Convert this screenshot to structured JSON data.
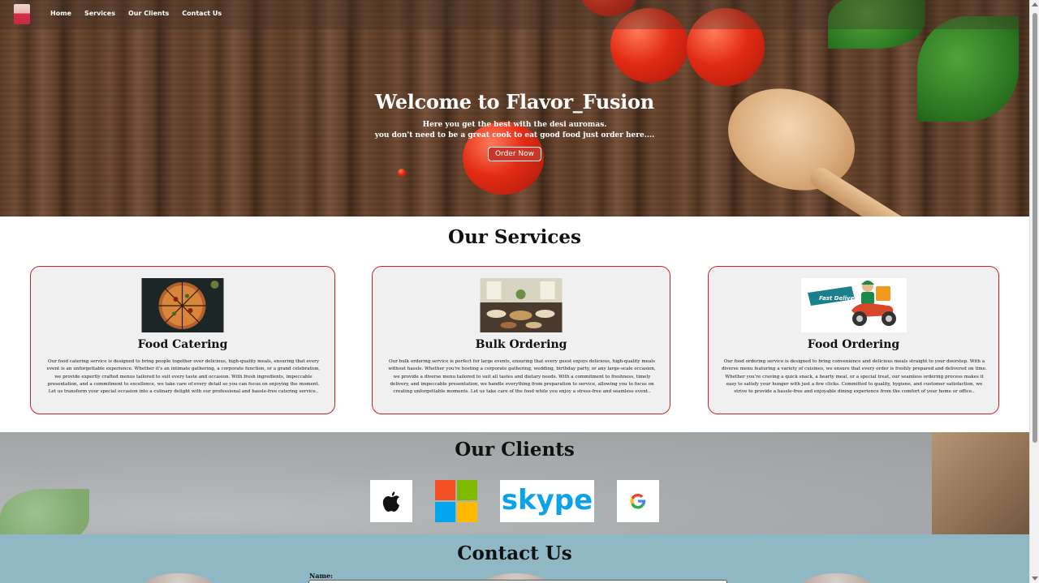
{
  "nav": {
    "links": [
      "Home",
      "Services",
      "Our Clients",
      "Contact Us"
    ]
  },
  "hero": {
    "title": "Welcome to Flavor_Fusion",
    "line1": "Here you get the best with the desi auromas.",
    "line2": "you don't need to be a great cook to eat good food just order here....",
    "button": "Order Now"
  },
  "services": {
    "title": "Our Services",
    "cards": [
      {
        "title": "Food Catering",
        "text": "Our food catering service is designed to bring people together over delicious, high-quality meals, ensuring that every event is an unforgettable experience. Whether it's an intimate gathering, a corporate function, or a grand celebration, we provide expertly crafted menus tailored to suit every taste and occasion. With fresh ingredients, impeccable presentation, and a commitment to excellence, we take care of every detail so you can focus on enjoying the moment. Let us transform your special occasion into a culinary delight with our professional and hassle-free catering service.."
      },
      {
        "title": "Bulk Ordering",
        "text": "Our bulk ordering service is perfect for large events, ensuring that every guest enjoys delicious, high-quality meals without hassle. Whether you're hosting a corporate gathering, wedding, birthday party, or any large-scale occasion, we provide a diverse menu tailored to suit all tastes and dietary needs. With a commitment to freshness, timely delivery, and impeccable presentation, we handle everything from preparation to service, allowing you to focus on creating unforgettable moments. Let us take care of the food while you enjoy a stress-free and seamless event.."
      },
      {
        "title": "Food Ordering",
        "text": "Our food ordering service is designed to bring convenience and delicious meals straight to your doorstep. With a diverse menu featuring a variety of cuisines, we ensure that every order is freshly prepared and delivered on time. Whether you're craving a quick snack, a hearty meal, or a special treat, our seamless ordering process makes it easy to satisfy your hunger with just a few clicks. Committed to quality, hygiene, and customer satisfaction, we strive to provide a hassle-free and enjoyable dining experience from the comfort of your home or office.."
      }
    ],
    "delivery_badge": "Fast Delivery"
  },
  "clients": {
    "title": "Our Clients",
    "logos": [
      "apple-logo",
      "microsoft-logo",
      "skype-logo",
      "google-logo"
    ],
    "skype_text": "skype"
  },
  "contact": {
    "title": "Contact Us",
    "name_label": "Name:"
  },
  "colors": {
    "accent_red": "#c2262b",
    "button_red": "#c7372a",
    "contact_bg": "#8fb8c4"
  }
}
